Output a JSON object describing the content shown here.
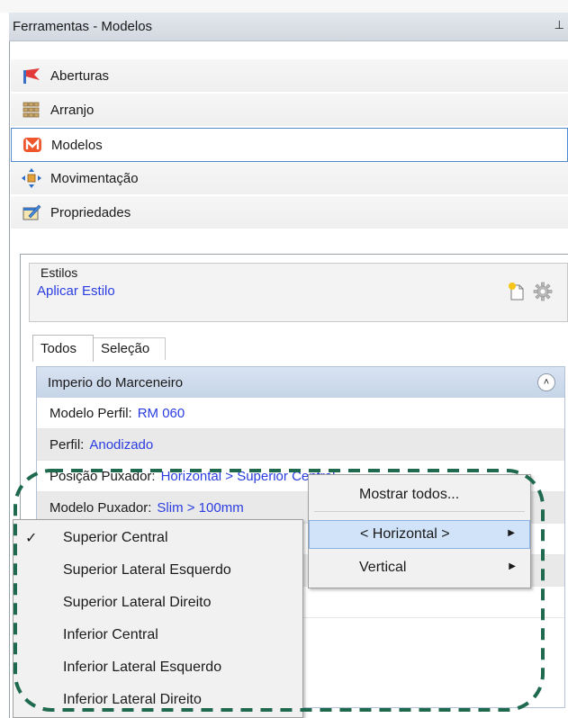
{
  "window": {
    "title": "Ferramentas - Modelos",
    "pin_glyph": "⊥"
  },
  "nav": {
    "items": [
      {
        "label": "Aberturas",
        "icon": "door-flag-icon"
      },
      {
        "label": "Arranjo",
        "icon": "grid-boxes-icon"
      },
      {
        "label": "Modelos",
        "icon": "m-logo-icon",
        "selected": true
      },
      {
        "label": "Movimentação",
        "icon": "move-arrows-icon"
      },
      {
        "label": "Propriedades",
        "icon": "properties-icon"
      }
    ]
  },
  "estilos": {
    "legend": "Estilos",
    "apply_link": "Aplicar Estilo"
  },
  "tabs": [
    {
      "label": "Todos",
      "active": true
    },
    {
      "label": "Seleção",
      "active": false
    }
  ],
  "grid": {
    "group_title": "Imperio do Marceneiro",
    "rows": [
      {
        "label": "Modelo Perfil:",
        "value": "RM 060"
      },
      {
        "label": "Perfil:",
        "value": "Anodizado"
      },
      {
        "label": "Posição Puxador:",
        "value": "Horizontal > Superior Central"
      },
      {
        "label": "Modelo Puxador:",
        "value": "Slim > 100mm"
      }
    ]
  },
  "submenu": {
    "items": [
      {
        "label": "Mostrar todos...",
        "has_arrow": false
      },
      {
        "label": "< Horizontal >",
        "has_arrow": true,
        "highlighted": true
      },
      {
        "label": "Vertical",
        "has_arrow": true
      }
    ]
  },
  "menu": {
    "items": [
      {
        "label": "Superior Central",
        "checked": true
      },
      {
        "label": "Superior Lateral Esquerdo"
      },
      {
        "label": "Superior Lateral Direito"
      },
      {
        "label": "Inferior Central"
      },
      {
        "label": "Inferior Lateral Esquerdo"
      },
      {
        "label": "Inferior Lateral Direito"
      }
    ]
  },
  "colors": {
    "link": "#2b3de0",
    "highlight_outline": "#1f6a4e",
    "selection": "#d1e3f9"
  }
}
